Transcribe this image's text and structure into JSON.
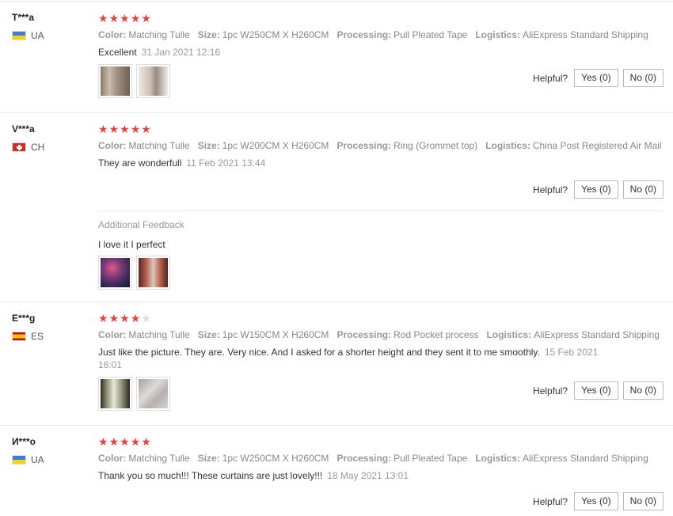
{
  "colors": {
    "star": "#f03c3c",
    "star_off": "#dcdcdc"
  },
  "helpful_label": "Helpful?",
  "reviews": [
    {
      "user": "T***a",
      "country": "UA",
      "flag_icon": "ukraine-flag-icon",
      "stars": 5,
      "attrs": [
        {
          "label": "Color:",
          "value": "Matching Tulle"
        },
        {
          "label": "Size:",
          "value": "1pc W250CM X H260CM"
        },
        {
          "label": "Processing:",
          "value": "Pull Pleated Tape"
        },
        {
          "label": "Logistics:",
          "value": "AliExpress Standard Shipping"
        }
      ],
      "text": "Excellent",
      "date": "31 Jan 2021 12:16",
      "yes": "Yes (0)",
      "no": "No (0)"
    },
    {
      "user": "V***a",
      "country": "CH",
      "flag_icon": "switzerland-flag-icon",
      "stars": 5,
      "attrs": [
        {
          "label": "Color:",
          "value": "Matching Tulle"
        },
        {
          "label": "Size:",
          "value": "1pc W200CM X H260CM"
        },
        {
          "label": "Processing:",
          "value": "Ring (Grommet top)"
        },
        {
          "label": "Logistics:",
          "value": "China Post Registered Air Mail"
        }
      ],
      "text": "They are wonderfull",
      "date": "11 Feb 2021 13:44",
      "yes": "Yes (0)",
      "no": "No (0)",
      "additional_title": "Additional Feedback",
      "additional_text": "I love it I perfect"
    },
    {
      "user": "E***g",
      "country": "ES",
      "flag_icon": "spain-flag-icon",
      "stars": 4,
      "attrs": [
        {
          "label": "Color:",
          "value": "Matching Tulle"
        },
        {
          "label": "Size:",
          "value": "1pc W150CM X H260CM"
        },
        {
          "label": "Processing:",
          "value": "Rod Pocket process"
        },
        {
          "label": "Logistics:",
          "value": "AliExpress Standard Shipping"
        }
      ],
      "text": "Just like the picture. They are. Very nice. And I asked for a shorter height and they sent it to me smoothly.",
      "date": "15 Feb 2021 16:01",
      "yes": "Yes (0)",
      "no": "No (0)"
    },
    {
      "user": "И***о",
      "country": "UA",
      "flag_icon": "ukraine-flag-icon",
      "stars": 5,
      "attrs": [
        {
          "label": "Color:",
          "value": "Matching Tulle"
        },
        {
          "label": "Size:",
          "value": "1pc W250CM X H260CM"
        },
        {
          "label": "Processing:",
          "value": "Pull Pleated Tape"
        },
        {
          "label": "Logistics:",
          "value": "AliExpress Standard Shipping"
        }
      ],
      "text": "Thank you so much!!! These curtains are just lovely!!!",
      "date": "18 May 2021 13:01",
      "yes": "Yes (0)",
      "no": "No (0)"
    }
  ]
}
